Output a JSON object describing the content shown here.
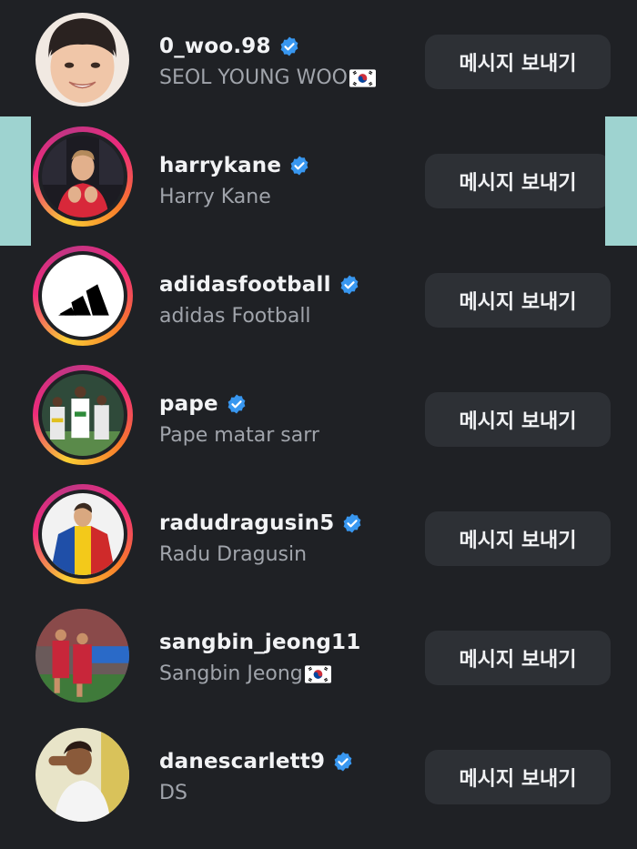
{
  "accounts": [
    {
      "username": "0_woo.98",
      "full_name": "SEOL YOUNG WOO",
      "verified": true,
      "flag": "korea-flag",
      "story_ring": false,
      "button": "메시지 보내기"
    },
    {
      "username": "harrykane",
      "full_name": "Harry Kane",
      "verified": true,
      "flag": "",
      "story_ring": true,
      "button": "메시지 보내기"
    },
    {
      "username": "adidasfootball",
      "full_name": "adidas Football",
      "verified": true,
      "flag": "",
      "story_ring": true,
      "button": "메시지 보내기"
    },
    {
      "username": "pape",
      "full_name": "Pape matar sarr",
      "verified": true,
      "flag": "",
      "story_ring": true,
      "button": "메시지 보내기"
    },
    {
      "username": "radudragusin5",
      "full_name": "Radu Dragusin",
      "verified": true,
      "flag": "",
      "story_ring": true,
      "button": "메시지 보내기"
    },
    {
      "username": "sangbin_jeong11",
      "full_name": "Sangbin Jeong",
      "verified": false,
      "flag": "korea-flag",
      "story_ring": false,
      "button": "메시지 보내기"
    },
    {
      "username": "danescarlett9",
      "full_name": "DS",
      "verified": true,
      "flag": "",
      "story_ring": false,
      "button": "메시지 보내기"
    }
  ],
  "colors": {
    "background": "#1f2125",
    "button_bg": "#2d3035",
    "verified_blue": "#3897f0",
    "side_bar": "#9ed3d0"
  }
}
